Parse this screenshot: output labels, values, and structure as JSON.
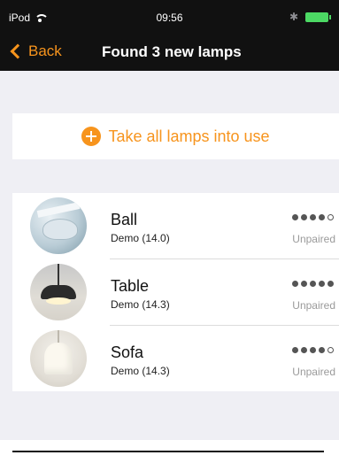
{
  "status_bar": {
    "carrier": "iPod",
    "time": "09:56"
  },
  "nav": {
    "back_label": "Back",
    "title": "Found 3 new lamps",
    "accent_color": "#f7941d"
  },
  "take_all": {
    "label": "Take all lamps into use"
  },
  "lamps": [
    {
      "name": "Ball",
      "subtitle": "Demo (14.0)",
      "signal_level": 4,
      "signal_max": 5,
      "status": "Unpaired",
      "icon": "ball-lamp-thumbnail"
    },
    {
      "name": "Table",
      "subtitle": "Demo (14.3)",
      "signal_level": 5,
      "signal_max": 5,
      "status": "Unpaired",
      "icon": "table-lamp-thumbnail"
    },
    {
      "name": "Sofa",
      "subtitle": "Demo (14.3)",
      "signal_level": 4,
      "signal_max": 5,
      "status": "Unpaired",
      "icon": "sofa-lamp-thumbnail"
    }
  ]
}
